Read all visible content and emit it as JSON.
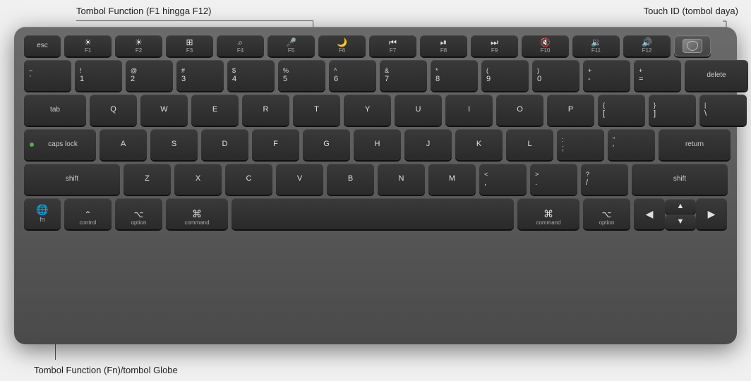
{
  "annotations": {
    "function_keys": "Tombol Function (F1 hingga F12)",
    "touch_id": "Touch ID (tombol daya)",
    "fn_globe": "Tombol Function (Fn)/tombol Globe"
  },
  "keyboard": {
    "rows": {
      "fn_row": [
        "esc",
        "F1",
        "F2",
        "F3",
        "F4",
        "F5",
        "F6",
        "F7",
        "F8",
        "F9",
        "F10",
        "F11",
        "F12",
        "TouchID"
      ],
      "num_row": [
        "~`",
        "!1",
        "@2",
        "#3",
        "$4",
        "%5",
        "^6",
        "&7",
        "*8",
        "(9",
        ")0",
        "-",
        "=+",
        "delete"
      ],
      "tab_row": [
        "tab",
        "Q",
        "W",
        "E",
        "R",
        "T",
        "Y",
        "U",
        "I",
        "O",
        "P",
        "{[",
        "}]",
        "|\\"
      ],
      "caps_row": [
        "caps lock",
        "A",
        "S",
        "D",
        "F",
        "G",
        "H",
        "J",
        "K",
        "L",
        ":;",
        "\"'",
        "return"
      ],
      "shift_row": [
        "shift",
        "Z",
        "X",
        "C",
        "V",
        "B",
        "N",
        "M",
        "<,",
        ">.",
        "?/",
        "shift"
      ],
      "bottom_row": [
        "fn/globe",
        "control",
        "option",
        "command",
        "space",
        "command",
        "option",
        "left",
        "up/down",
        "right"
      ]
    }
  }
}
